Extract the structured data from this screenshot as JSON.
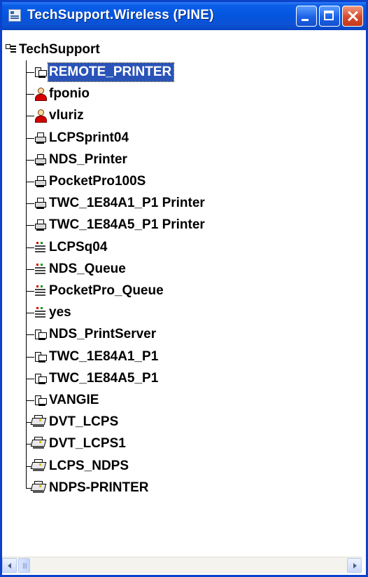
{
  "window": {
    "title": "TechSupport.Wireless (PINE)",
    "icon": "app-tree-icon"
  },
  "tree": {
    "root": {
      "label": "TechSupport",
      "icon": "container-tree-icon"
    },
    "items": [
      {
        "label": "REMOTE_PRINTER",
        "icon": "print-server-icon",
        "selected": true
      },
      {
        "label": "fponio",
        "icon": "user-icon"
      },
      {
        "label": "vluriz",
        "icon": "user-icon"
      },
      {
        "label": "LCPSprint04",
        "icon": "printer-icon"
      },
      {
        "label": "NDS_Printer",
        "icon": "printer-icon"
      },
      {
        "label": "PocketPro100S",
        "icon": "printer-icon"
      },
      {
        "label": "TWC_1E84A1_P1 Printer",
        "icon": "printer-icon"
      },
      {
        "label": "TWC_1E84A5_P1 Printer",
        "icon": "printer-icon"
      },
      {
        "label": "LCPSq04",
        "icon": "print-queue-icon"
      },
      {
        "label": "NDS_Queue",
        "icon": "print-queue-icon"
      },
      {
        "label": "PocketPro_Queue",
        "icon": "print-queue-icon"
      },
      {
        "label": "yes",
        "icon": "print-queue-icon"
      },
      {
        "label": "NDS_PrintServer",
        "icon": "print-server-icon"
      },
      {
        "label": "TWC_1E84A1_P1",
        "icon": "print-server-icon"
      },
      {
        "label": "TWC_1E84A5_P1",
        "icon": "print-server-icon"
      },
      {
        "label": "VANGIE",
        "icon": "print-server-icon"
      },
      {
        "label": "DVT_LCPS",
        "icon": "ndps-manager-icon"
      },
      {
        "label": "DVT_LCPS1",
        "icon": "ndps-manager-icon"
      },
      {
        "label": "LCPS_NDPS",
        "icon": "ndps-manager-icon"
      },
      {
        "label": "NDPS-PRINTER",
        "icon": "ndps-printer-icon"
      }
    ]
  },
  "colors": {
    "titlebar": "#0356e0",
    "selection": "#2a53b8",
    "close_button": "#d8492c"
  }
}
